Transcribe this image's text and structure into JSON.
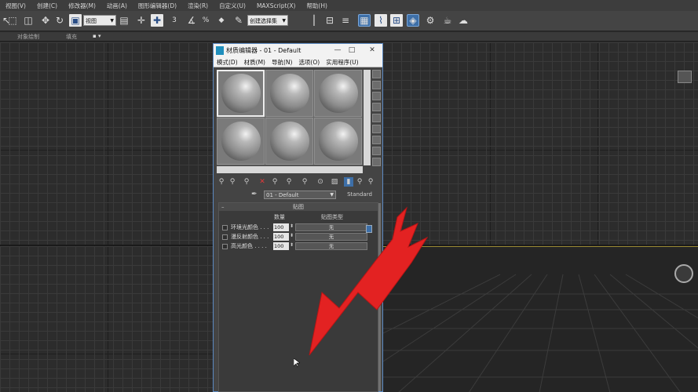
{
  "menubar": {
    "items": [
      "视图(V)",
      "创建(C)",
      "修改器(M)",
      "动画(A)",
      "图形编辑器(D)",
      "渲染(R)",
      "自定义(U)",
      "MAXScript(X)",
      "帮助(H)"
    ]
  },
  "toolbar": {
    "view_select": "视图",
    "selection_set": "创建选择集"
  },
  "ribbon": {
    "tab_object_paint": "对象绘制",
    "tab_fill": "填充"
  },
  "dialog": {
    "title": "材质编辑器 - 01 - Default",
    "menu": [
      "模式(D)",
      "材质(M)",
      "导航(N)",
      "选项(O)",
      "实用程序(U)"
    ],
    "material_name": "01 - Default",
    "material_type": "Standard",
    "maps_panel": {
      "header": "贴图",
      "col_amount": "数量",
      "col_map_type": "贴图类型",
      "rows": [
        {
          "label": "环境光颜色 . . .",
          "amount": "100",
          "map": "无"
        },
        {
          "label": "漫反射颜色 . . .",
          "amount": "100",
          "map": "无"
        },
        {
          "label": "高光颜色 . . . .",
          "amount": "100",
          "map": "无"
        }
      ]
    }
  },
  "icons": [
    "material-editor-logo-icon",
    "sphere-icon",
    "arrow-down-icon"
  ],
  "colors": {
    "annotation_arrow": "#e32222",
    "dialog_border": "#5c8ac2",
    "viewport_bg": "#2c2c2c"
  }
}
